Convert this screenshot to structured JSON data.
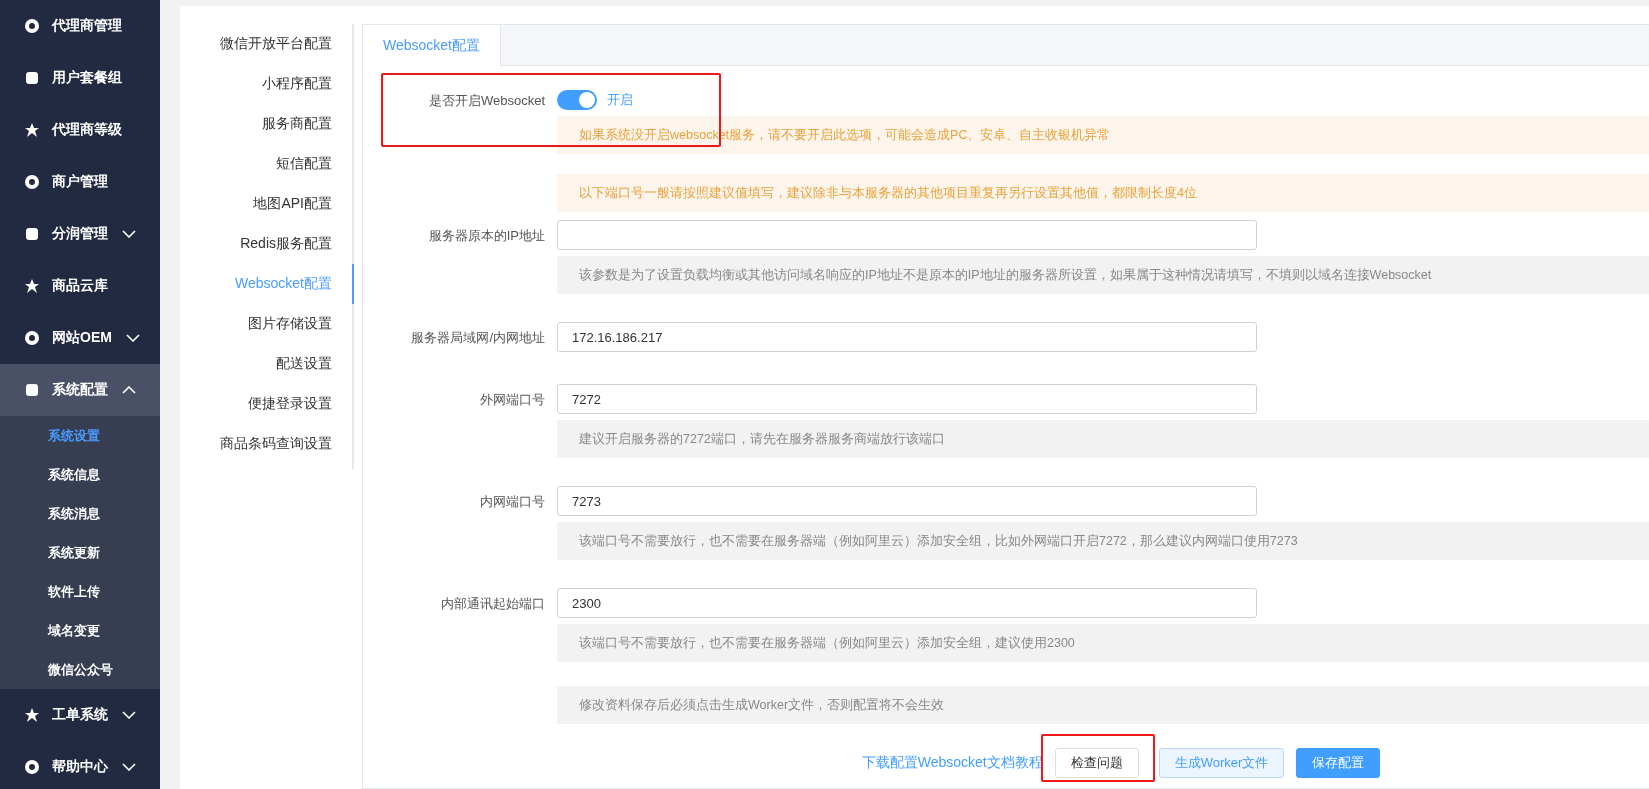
{
  "sidebar": {
    "items": [
      {
        "label": "代理商管理",
        "selected": false
      },
      {
        "label": "用户套餐组",
        "selected": false
      },
      {
        "label": "代理商等级",
        "selected": false
      },
      {
        "label": "商户管理",
        "selected": false
      },
      {
        "label": "分润管理",
        "selected": false,
        "expanded": false
      },
      {
        "label": "商品云库",
        "selected": false
      },
      {
        "label": "网站OEM",
        "selected": false,
        "expanded": false
      },
      {
        "label": "系统配置",
        "selected": true,
        "expanded": true,
        "children": [
          {
            "label": "系统设置",
            "selected": true
          },
          {
            "label": "系统信息",
            "selected": false
          },
          {
            "label": "系统消息",
            "selected": false
          },
          {
            "label": "系统更新",
            "selected": false
          },
          {
            "label": "软件上传",
            "selected": false
          },
          {
            "label": "域名变更",
            "selected": false
          },
          {
            "label": "微信公众号",
            "selected": false
          }
        ]
      },
      {
        "label": "工单系统",
        "selected": false,
        "expanded": false
      },
      {
        "label": "帮助中心",
        "selected": false,
        "expanded": false
      }
    ]
  },
  "config_nav": [
    {
      "label": "微信开放平台配置",
      "selected": false
    },
    {
      "label": "小程序配置",
      "selected": false
    },
    {
      "label": "服务商配置",
      "selected": false
    },
    {
      "label": "短信配置",
      "selected": false
    },
    {
      "label": "地图API配置",
      "selected": false
    },
    {
      "label": "Redis服务配置",
      "selected": false
    },
    {
      "label": "Websocket配置",
      "selected": true
    },
    {
      "label": "图片存储设置",
      "selected": false
    },
    {
      "label": "配送设置",
      "selected": false
    },
    {
      "label": "便捷登录设置",
      "selected": false
    },
    {
      "label": "商品条码查询设置",
      "selected": false
    }
  ],
  "tabs": [
    {
      "label": "Websocket配置",
      "selected": true
    }
  ],
  "form": [
    {
      "kind": "switch",
      "label": "是否开启Websocket",
      "on": true,
      "state_text": "开启"
    },
    {
      "kind": "warning",
      "text": "如果系统没开启websocket服务，请不要开启此选项，可能会造成PC、安卓、自主收银机异常"
    },
    {
      "kind": "warning",
      "text": "以下端口号一般请按照建议值填写，建议除非与本服务器的其他项目重复再另行设置其他值，都限制长度4位"
    },
    {
      "kind": "input",
      "label": "服务器原本的IP地址"
    },
    {
      "kind": "hint",
      "text": "该参数是为了设置负载均衡或其他访问域名响应的IP地址不是原本的IP地址的服务器所设置，如果属于这种情况请填写，不填则以域名连接Websocket"
    },
    {
      "kind": "input",
      "label": "服务器局域网/内网地址",
      "value": "172.16.186.217"
    },
    {
      "kind": "input",
      "label": "外网端口号",
      "value": "7272"
    },
    {
      "kind": "hint",
      "text": "建议开启服务器的7272端口，请先在服务器服务商端放行该端口"
    },
    {
      "kind": "input",
      "label": "内网端口号",
      "value": "7273"
    },
    {
      "kind": "hint",
      "text": "该端口号不需要放行，也不需要在服务器端（例如阿里云）添加安全组，比如外网端口开启7272，那么建议内网端口使用7273"
    },
    {
      "kind": "input",
      "label": "内部通讯起始端口",
      "value": "2300"
    },
    {
      "kind": "hint",
      "text": "该端口号不需要放行，也不需要在服务器端（例如阿里云）添加安全组，建议使用2300"
    },
    {
      "kind": "hint",
      "text": "修改资料保存后必须点击生成Worker文件，否则配置将不会生效"
    }
  ],
  "actions": [
    {
      "kind": "link",
      "label": "下载配置Websocket文档教程"
    },
    {
      "kind": "plain",
      "label": "检查问题"
    },
    {
      "kind": "light",
      "label": "生成Worker文件"
    },
    {
      "kind": "primary",
      "label": "保存配置"
    }
  ]
}
